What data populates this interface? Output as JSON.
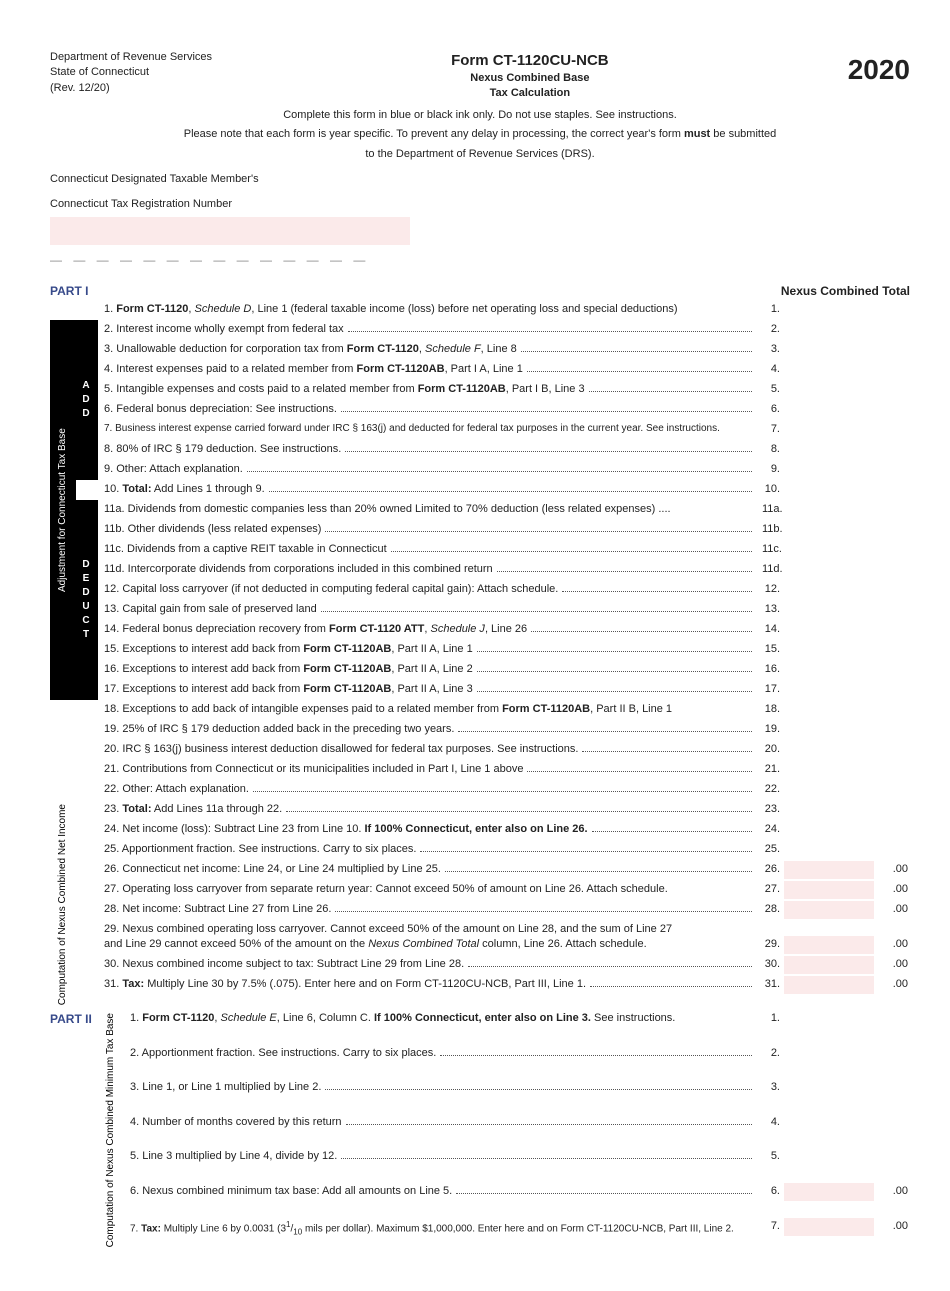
{
  "header": {
    "dept": "Department of Revenue Services",
    "state": "State of Connecticut",
    "rev": "(Rev. 12/20)",
    "form_no": "Form CT-1120CU-NCB",
    "subtitle1": "Nexus Combined Base",
    "subtitle2": "Tax Calculation",
    "year": "2020",
    "instr1": "Complete this form in blue or black ink only. Do not use staples. See instructions.",
    "instr2a": "Please note that each form is year specific. To prevent any delay in processing, the correct year's form ",
    "instr2b": "must",
    "instr2c": " be submitted",
    "instr3": "to the Department of Revenue Services (DRS).",
    "member1": "Connecticut Designated Taxable Member's",
    "member2": "Connecticut Tax Registration Number",
    "dashes": "— — — — — — — — — — — — — —"
  },
  "part1_label": "PART I",
  "col_header": "Nexus Combined Total",
  "side": {
    "adj": "Adjustment for Connecticut Tax Base",
    "add": "A D D",
    "deduct": "D E D U C T",
    "comp_net": "Computation of Nexus Combined Net Income",
    "comp_min": "Computation of Nexus Combined Minimum Tax Base"
  },
  "part1": {
    "l1a": "1. ",
    "l1b": "Form CT-1120",
    "l1c": ", ",
    "l1d": "Schedule D",
    "l1e": ", Line 1 (federal taxable income (loss) before net operating loss and special deductions)",
    "l1n": "1.",
    "l2": "2. Interest income wholly exempt from federal tax",
    "l2n": "2.",
    "l3a": "3. Unallowable deduction for corporation tax from ",
    "l3b": "Form CT-1120",
    "l3c": ", ",
    "l3d": "Schedule F",
    "l3e": ", Line 8",
    "l3n": "3.",
    "l4a": "4. Interest expenses paid to a related member from ",
    "l4b": "Form CT-1120AB",
    "l4c": ", Part I A, Line 1",
    "l4n": "4.",
    "l5a": "5. Intangible expenses and costs paid to a related member from ",
    "l5b": "Form CT-1120AB",
    "l5c": ", Part I B, Line 3",
    "l5n": "5.",
    "l6": "6. Federal bonus depreciation: See instructions.",
    "l6n": "6.",
    "l7": "7. Business interest expense carried forward under IRC § 163(j) and deducted for federal tax purposes in the current year. See instructions.",
    "l7n": "7.",
    "l8": "8. 80% of IRC § 179 deduction. See instructions.",
    "l8n": "8.",
    "l9": "9. Other: Attach explanation.",
    "l9n": "9.",
    "l10a": "10. ",
    "l10b": "Total:",
    "l10c": " Add Lines 1 through 9.",
    "l10n": "10.",
    "l11a": "11a. Dividends from domestic companies less than 20% owned Limited to 70% deduction (less related expenses) ....",
    "l11an": "11a.",
    "l11b": "11b. Other dividends (less related expenses)",
    "l11bn": "11b.",
    "l11c": "11c. Dividends from a captive REIT taxable in Connecticut",
    "l11cn": "11c.",
    "l11d": "11d. Intercorporate dividends from corporations included in this combined return",
    "l11dn": "11d.",
    "l12": "12. Capital loss carryover (if not deducted in computing federal capital gain): Attach schedule.",
    "l12n": "12.",
    "l13": "13. Capital gain from sale of preserved land",
    "l13n": "13.",
    "l14a": "14. Federal bonus depreciation recovery from ",
    "l14b": "Form CT-1120 ATT",
    "l14c": ", ",
    "l14d": "Schedule J",
    "l14e": ", Line 26",
    "l14n": "14.",
    "l15a": "15. Exceptions to interest add back from ",
    "l15b": "Form CT-1120AB",
    "l15c": ", Part II A, Line 1",
    "l15n": "15.",
    "l16a": "16. Exceptions to interest add back from ",
    "l16b": "Form CT-1120AB",
    "l16c": ", Part II A, Line 2",
    "l16n": "16.",
    "l17a": "17. Exceptions to interest add back from ",
    "l17b": "Form CT-1120AB",
    "l17c": ", Part II A, Line 3",
    "l17n": "17.",
    "l18a": "18. Exceptions to add back of intangible expenses paid to a related member from ",
    "l18b": "Form CT-1120AB",
    "l18c": ", Part II B, Line 1",
    "l18n": "18.",
    "l19": "19. 25% of IRC § 179 deduction added back in the preceding two years.",
    "l19n": "19.",
    "l20": "20. IRC § 163(j) business interest deduction disallowed for federal tax purposes. See instructions.",
    "l20n": "20.",
    "l21": "21. Contributions from Connecticut or its municipalities included in Part I, Line 1 above",
    "l21n": "21.",
    "l22": "22. Other: Attach explanation.",
    "l22n": "22.",
    "l23a": "23. ",
    "l23b": "Total:",
    "l23c": " Add Lines 11a through 22.",
    "l23n": "23.",
    "l24a": "24. Net income (loss): Subtract Line 23 from Line 10. ",
    "l24b": "If 100% Connecticut, enter also on Line 26.",
    "l24n": "24.",
    "l25": "25. Apportionment fraction. See instructions. Carry to six places.",
    "l25n": "25.",
    "l26": "26. Connecticut net income: Line 24, or Line 24 multiplied by Line 25.",
    "l26n": "26.",
    "l27": "27. Operating loss carryover from separate return year: Cannot exceed 50% of amount on Line 26. Attach schedule.",
    "l27n": "27.",
    "l28": "28. Net income: Subtract Line 27 from Line 26.",
    "l28n": "28.",
    "l29a": "29. Nexus combined operating loss carryover. Cannot exceed 50% of the amount on Line 28, and the sum of Line 27",
    "l29b": "and Line 29 cannot exceed 50% of the amount on the ",
    "l29c": "Nexus Combined Total",
    "l29d": " column, Line 26. Attach schedule.",
    "l29n": "29.",
    "l30": "30. Nexus combined income subject to tax: Subtract Line 29 from Line 28.",
    "l30n": "30.",
    "l31a": "31. ",
    "l31b": "Tax:",
    "l31c": " Multiply Line 30 by 7.5% (.075). Enter here and on Form CT-1120CU-NCB, Part III, Line 1.",
    "l31n": "31."
  },
  "part2_label": "PART II",
  "part2": {
    "l1a": "1. ",
    "l1b": "Form CT-1120",
    "l1c": ", ",
    "l1d": "Schedule E",
    "l1e": ", Line 6, Column C. ",
    "l1f": "If 100% Connecticut, enter also on Line 3.",
    "l1g": " See instructions.",
    "l1n": "1.",
    "l2": "2. Apportionment fraction. See instructions. Carry to six places.",
    "l2n": "2.",
    "l3": "3. Line 1, or Line 1 multiplied by Line 2.",
    "l3n": "3.",
    "l4": "4. Number of months covered by this return",
    "l4n": "4.",
    "l5": "5. Line 3 multiplied by Line 4, divide by 12.",
    "l5n": "5.",
    "l6": "6. Nexus combined minimum tax base: Add all amounts on Line 5.",
    "l6n": "6.",
    "l7a": "7. ",
    "l7b": "Tax:",
    "l7c": " Multiply Line 6 by 0.0031 (3",
    "l7d": "1",
    "l7e": "/",
    "l7f": "10",
    "l7g": " mils per dollar). Maximum $1,000,000. Enter here and on Form CT-1120CU-NCB, Part III, Line 2.",
    "l7n": "7."
  },
  "cents": ".00"
}
